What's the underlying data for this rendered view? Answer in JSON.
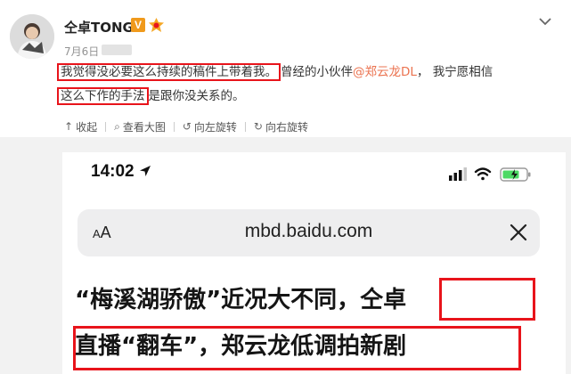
{
  "post": {
    "username": "仝卓TONG",
    "verified_badge": "V",
    "date": "7月6日",
    "text_line1_marked": "我觉得没必要这么持续的稿件上带着我。",
    "text_line1_rest": "曾经的小伙伴",
    "mention": "@郑云龙DL",
    "text_line1_tail": "， 我宁愿相信",
    "text_line2_marked": "这么下作的手法",
    "text_line2_rest": "是跟你没关系的。"
  },
  "toolbar": {
    "collapse": {
      "icon": "collapse-up-icon",
      "glyph": "↑",
      "label": "收起"
    },
    "view_large": {
      "icon": "magnifier-icon",
      "glyph": "⌕",
      "label": "查看大图"
    },
    "rotate_left": {
      "icon": "rotate-left-icon",
      "glyph": "↺",
      "label": "向左旋转"
    },
    "rotate_right": {
      "icon": "rotate-right-icon",
      "glyph": "↻",
      "label": "向右旋转"
    }
  },
  "image": {
    "time": "14:02",
    "aa_label_small": "A",
    "aa_label_large": "A",
    "url": "mbd.baidu.com",
    "headline_line1": "“梅溪湖骄傲”近况大不同，仝卓",
    "headline_line2": "直播“翻车”，郑云龙低调拍新剧"
  },
  "colors": {
    "mark_red": "#e8141b",
    "mention": "#eb7350",
    "badge_orange": "#f09a1c",
    "battery_green": "#4cd964"
  }
}
